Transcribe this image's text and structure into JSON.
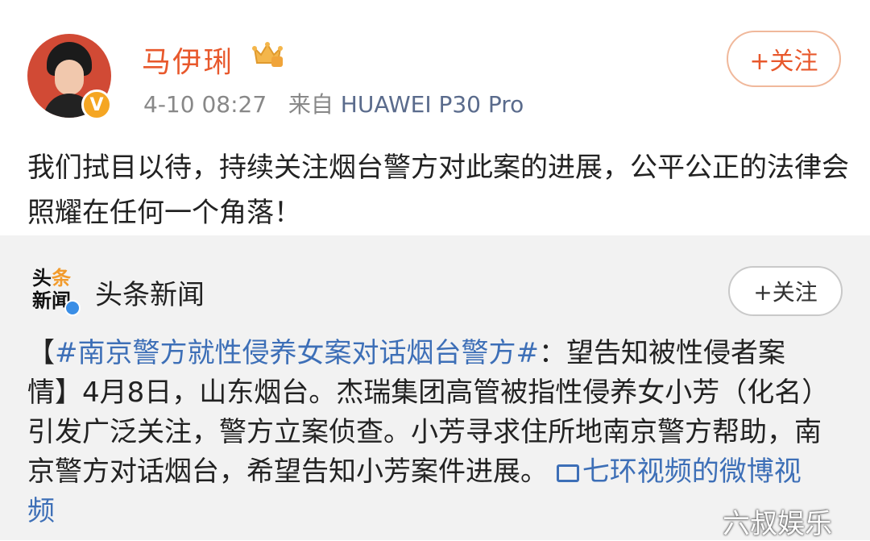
{
  "post": {
    "author": "马伊琍",
    "date": "4-10 08:27",
    "source_prefix": "来自",
    "source": "HUAWEI P30 Pro",
    "follow_label": "+关注",
    "text": "我们拭目以待，持续关注烟台警方对此案的进展，公平公正的法律会照耀在任何一个角落！"
  },
  "repost": {
    "author": "头条新闻",
    "logo_line1_a": "头",
    "logo_line1_b": "条",
    "logo_line2": "新闻",
    "follow_label": "+关注",
    "text_prefix": "【",
    "hashtag": "#南京警方就性侵养女案对话烟台警方#",
    "text_body": "：望告知被性侵者案情】4月8日，山东烟台。杰瑞集团高管被指性侵养女小芳（化名）引发广泛关注，警方立案侦查。小芳寻求住所地南京警方帮助，南京警方对话烟台，希望告知小芳案件进展。",
    "video_label": "七环视频的微博视频"
  },
  "watermark": "六叔娱乐",
  "colors": {
    "name": "#e8582c",
    "link": "#3d6fb7",
    "repost_bg": "#f2f2f2"
  },
  "icons": [
    "vip-crown-icon",
    "verified-badge-icon",
    "video-icon"
  ]
}
